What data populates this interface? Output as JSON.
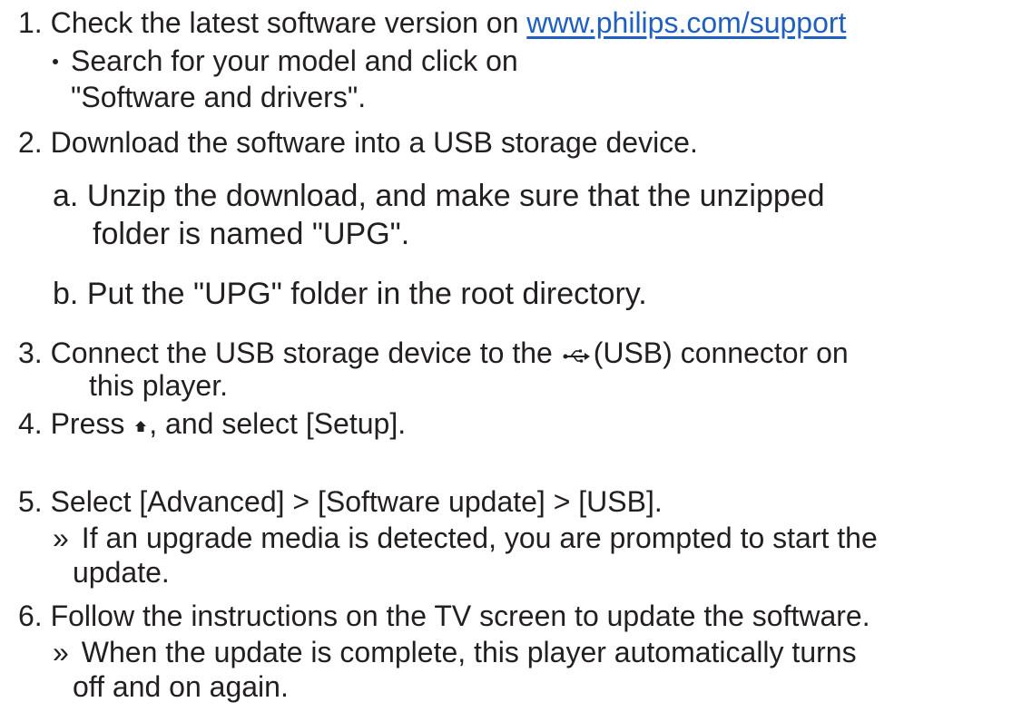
{
  "steps": {
    "s1": {
      "num": "1.",
      "text": "Check the latest software version on",
      "link": "www.philips.com/support",
      "bullet_l1": "Search for your model and click on",
      "bullet_l2": "\"Software and drivers\"."
    },
    "s2": {
      "num": "2.",
      "text": "Download the software into a USB storage  device.",
      "a_label": "a.",
      "a_l1": "Unzip the download, and make sure  that the unzipped",
      "a_l2": "folder is named  \"UPG\".",
      "b_label": "b.",
      "b_text": "Put the \"UPG\" folder in the root  directory."
    },
    "s3": {
      "num": "3.",
      "text_before": "Connect the USB storage device to the",
      "usb_icon": "usb-icon",
      "text_after": "(USB) connector on",
      "l2": "this player."
    },
    "s4": {
      "num": "4.",
      "text_before": "Press",
      "home_icon": "home-icon",
      "text_after": ", and select [Setup]."
    },
    "s5": {
      "num": "5.",
      "text": "Select [Advanced] > [Software update] > [USB].",
      "result_mark": "»",
      "r_l1": "If an upgrade media is detected, you  are prompted to start the",
      "r_l2": "update."
    },
    "s6": {
      "num": "6.",
      "text": "Follow the instructions on the TV screen  to update the software.",
      "result_mark": "»",
      "r_l1": "When the update is complete, this  player automatically turns",
      "r_l2": "off and on  again."
    }
  },
  "colors": {
    "text": "#231f20",
    "link": "#1f5fbf"
  }
}
